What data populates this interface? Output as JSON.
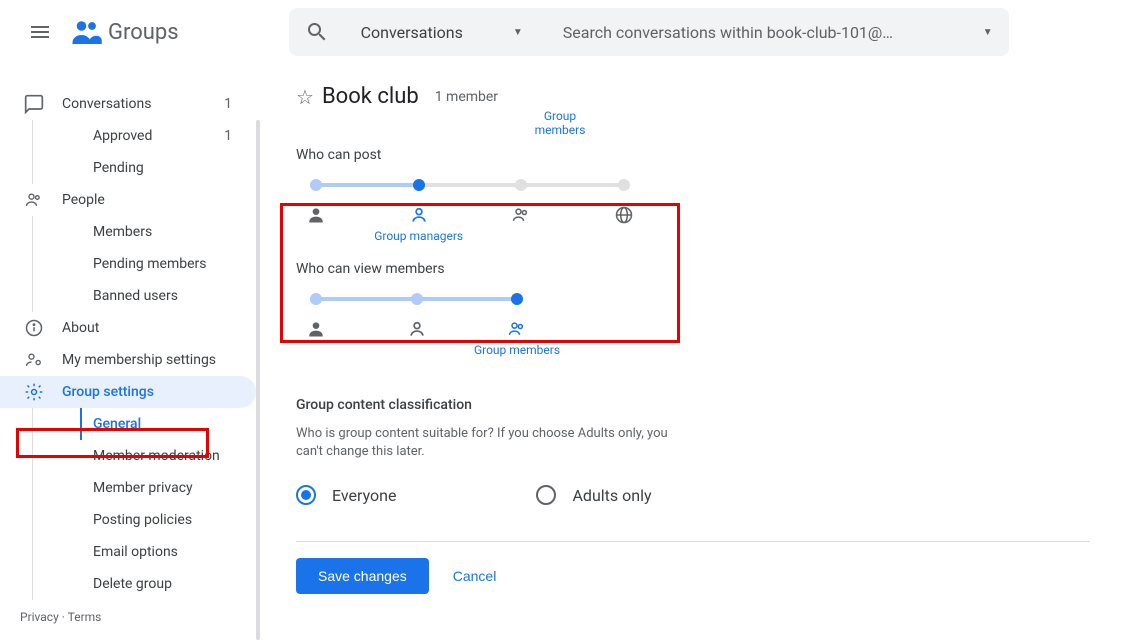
{
  "header": {
    "app_name": "Groups",
    "search_type": "Conversations",
    "search_placeholder": "Search conversations within book-club-101@…"
  },
  "sidebar": {
    "conversations": {
      "label": "Conversations",
      "count": "1"
    },
    "approved": {
      "label": "Approved",
      "count": "1"
    },
    "pending": {
      "label": "Pending"
    },
    "people": {
      "label": "People"
    },
    "members": {
      "label": "Members"
    },
    "pending_members": {
      "label": "Pending members"
    },
    "banned_users": {
      "label": "Banned users"
    },
    "about": {
      "label": "About"
    },
    "my_membership": {
      "label": "My membership settings"
    },
    "group_settings": {
      "label": "Group settings"
    },
    "general": {
      "label": "General"
    },
    "member_moderation": {
      "label": "Member moderation"
    },
    "member_privacy": {
      "label": "Member privacy"
    },
    "posting_policies": {
      "label": "Posting policies"
    },
    "email_options": {
      "label": "Email options"
    },
    "delete_group": {
      "label": "Delete group"
    }
  },
  "page": {
    "title": "Book club",
    "member_count": "1 member",
    "top_slider_label": "Group members",
    "who_can_post": {
      "label": "Who can post",
      "selected_index": 1,
      "options": [
        "Group owners",
        "Group managers",
        "Group members",
        "Anyone on the web"
      ],
      "selected_label": "Group managers"
    },
    "who_can_view_members": {
      "label": "Who can view members",
      "selected_index": 2,
      "options": [
        "Group owners",
        "Group managers",
        "Group members"
      ],
      "selected_label": "Group members"
    },
    "classification": {
      "title": "Group content classification",
      "desc": "Who is group content suitable for? If you choose Adults only, you can't change this later.",
      "everyone": "Everyone",
      "adults_only": "Adults only"
    },
    "actions": {
      "save": "Save changes",
      "cancel": "Cancel"
    }
  },
  "footer": {
    "privacy": "Privacy",
    "terms": "Terms"
  }
}
